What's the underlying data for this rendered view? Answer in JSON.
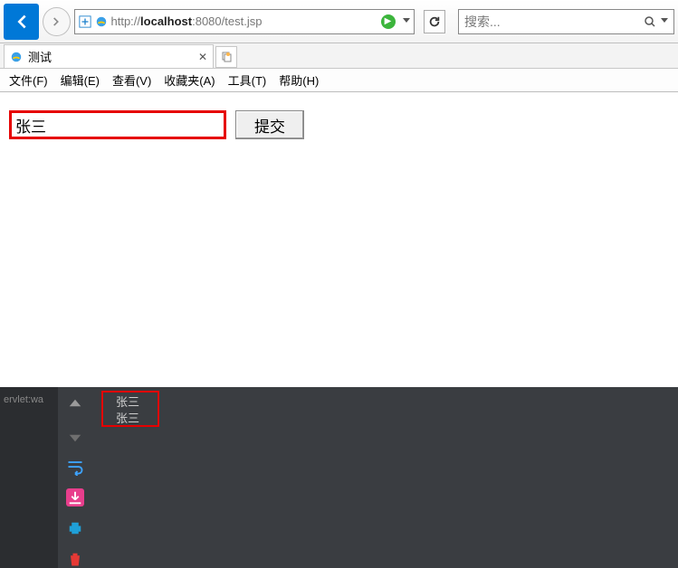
{
  "nav": {
    "url_prefix": "http://",
    "url_host": "localhost",
    "url_port": ":8080",
    "url_path": "/test.jsp"
  },
  "search": {
    "placeholder": "搜索..."
  },
  "tabs": {
    "active": {
      "title": "测试"
    }
  },
  "menu": {
    "file": "文件(F)",
    "edit": "编辑(E)",
    "view": "查看(V)",
    "favorites": "收藏夹(A)",
    "tools": "工具(T)",
    "help": "帮助(H)"
  },
  "form": {
    "input_value": "张三",
    "submit_label": "提交"
  },
  "devtools": {
    "left_label": "ervlet:wa",
    "log1": "张三",
    "log2": "张三"
  }
}
